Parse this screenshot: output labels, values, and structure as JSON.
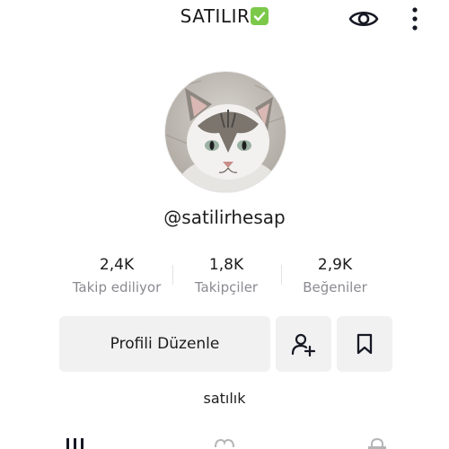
{
  "header": {
    "title": "SATILIR",
    "title_emoji": "check-mark-icon",
    "icons": [
      "eye-icon",
      "more-vertical-icon"
    ]
  },
  "profile": {
    "username": "@satilirhesap",
    "bio": "satılık",
    "avatar": "cat-avatar"
  },
  "stats": [
    {
      "value": "2,4K",
      "label": "Takip ediliyor"
    },
    {
      "value": "1,8K",
      "label": "Takipçiler"
    },
    {
      "value": "2,9K",
      "label": "Beğeniler"
    }
  ],
  "actions": {
    "edit_label": "Profili Düzenle",
    "add_friend_icon": "add-user-icon",
    "bookmark_icon": "bookmark-icon"
  },
  "tabs": [
    "grid-icon",
    "liked-icon",
    "lock-icon"
  ],
  "colors": {
    "background": "#ffffff",
    "button_bg": "#f1f1f2",
    "muted_text": "#8a8b91",
    "check_green": "#7cc94a"
  }
}
